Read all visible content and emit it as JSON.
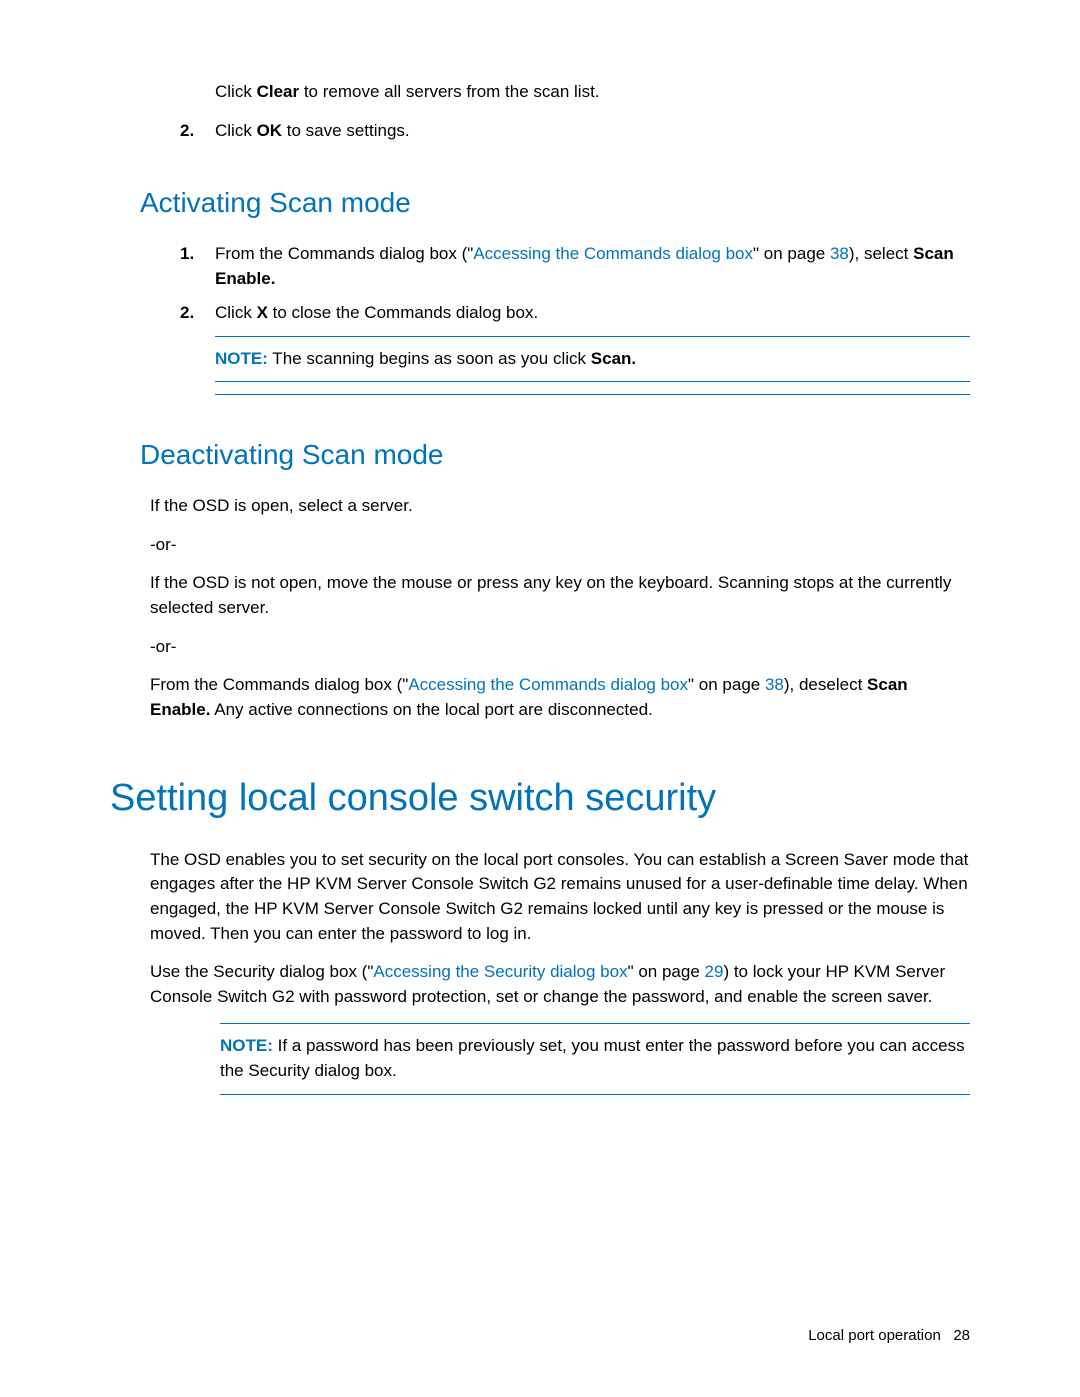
{
  "intro": {
    "line1_a": "Click ",
    "line1_b": "Clear",
    "line1_c": " to remove all servers from the scan list.",
    "list_num": "2.",
    "list_a": "Click ",
    "list_b": "OK",
    "list_c": " to save settings."
  },
  "activating": {
    "heading": "Activating Scan mode",
    "item1_num": "1.",
    "item1_a": "From the Commands dialog box (\"",
    "item1_link": "Accessing the Commands dialog box",
    "item1_b": "\" on page ",
    "item1_page": "38",
    "item1_c": "), select ",
    "item1_bold": "Scan Enable.",
    "item2_num": "2.",
    "item2_a": "Click ",
    "item2_b": "X",
    "item2_c": " to close the Commands dialog box.",
    "note_label": "NOTE:",
    "note_a": "  The scanning begins as soon as you click ",
    "note_b": "Scan."
  },
  "deactivating": {
    "heading": "Deactivating Scan mode",
    "p1": "If the OSD is open, select a server.",
    "or1": "-or-",
    "p2": "If the OSD is not open, move the mouse or press any key on the keyboard. Scanning stops at the currently selected server.",
    "or2": "-or-",
    "p3_a": "From the Commands dialog box (\"",
    "p3_link": "Accessing the Commands dialog box",
    "p3_b": "\" on page ",
    "p3_page": "38",
    "p3_c": "), deselect ",
    "p3_bold": "Scan Enable.",
    "p3_d": " Any active connections on the local port are disconnected."
  },
  "security": {
    "heading": "Setting local console switch security",
    "p1": "The OSD enables you to set security on the local port consoles. You can establish a Screen Saver mode that engages after the HP KVM Server Console Switch G2 remains unused for a user-definable time delay. When engaged, the HP KVM Server Console Switch G2 remains locked until any key is pressed or the mouse is moved. Then you can enter the password to log in.",
    "p2_a": "Use the Security dialog box (\"",
    "p2_link": "Accessing the Security dialog box",
    "p2_b": "\" on page ",
    "p2_page": "29",
    "p2_c": ") to lock your HP KVM Server Console Switch G2 with password protection, set or change the password, and enable the screen saver.",
    "note_label": "NOTE:",
    "note_text": "  If a password has been previously set, you must enter the password before you can access the Security dialog box."
  },
  "footer": {
    "section": "Local port operation",
    "page": "28"
  }
}
